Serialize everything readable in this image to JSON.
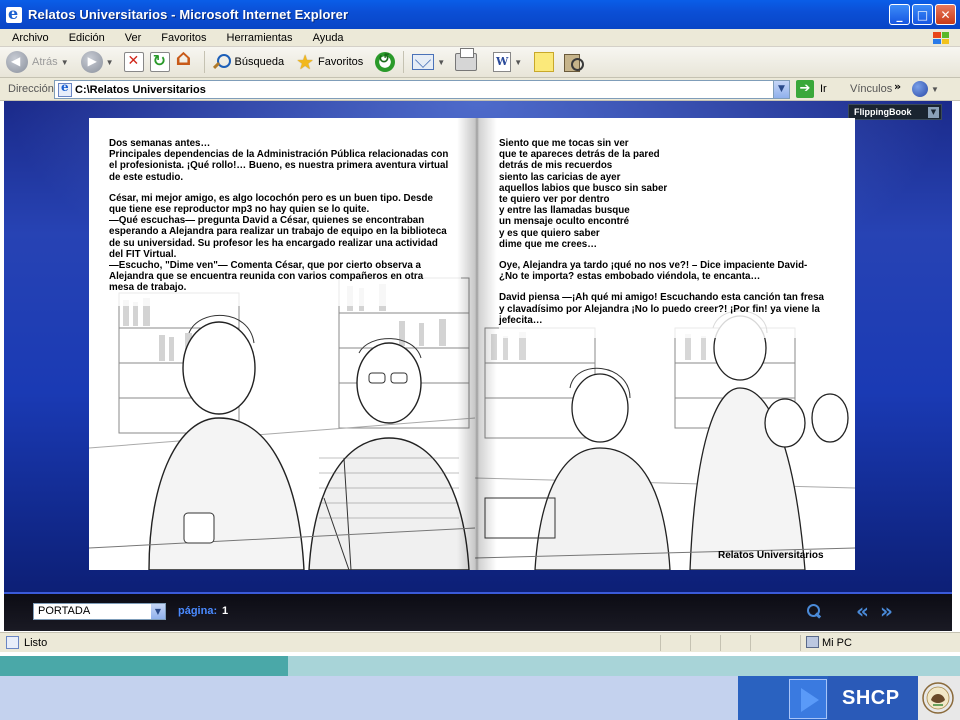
{
  "window": {
    "title": "Relatos Universitarios - Microsoft Internet Explorer",
    "controls": [
      "minimize",
      "maximize",
      "close"
    ]
  },
  "menu": {
    "items": [
      "Archivo",
      "Edición",
      "Ver",
      "Favoritos",
      "Herramientas",
      "Ayuda"
    ]
  },
  "toolbar": {
    "back_label": "Atrás",
    "search_label": "Búsqueda",
    "favorites_label": "Favoritos",
    "word_glyph": "W"
  },
  "address": {
    "label": "Dirección",
    "value": "C:\\Relatos Universitarios",
    "go_label": "Ir",
    "links_label": "Vínculos",
    "links_chevron": "»"
  },
  "viewer": {
    "tab_label": "FlippingBook",
    "left_page": {
      "paragraphs": [
        [
          "Dos semanas antes…",
          "Principales dependencias de la Administración Pública relacionadas con",
          "el profesionista. ¡Qué rollo!… Bueno, es nuestra primera aventura virtual",
          "de este estudio."
        ],
        [
          "César, mi mejor amigo, es algo locochón pero es  un buen tipo. Desde",
          "que tiene ese reproductor mp3 no hay quien se lo quite.",
          "—Qué escuchas— pregunta David a César, quienes se encontraban",
          "esperando a Alejandra para realizar un trabajo de equipo en la biblioteca",
          "de su universidad. Su profesor les ha encargado realizar una actividad",
          "del FIT Virtual.",
          "—Escucho, \"Dime ven\"— Comenta César, que por cierto observa a",
          "Alejandra que se encuentra reunida con varios compañeros en otra",
          "mesa de trabajo."
        ]
      ]
    },
    "right_page": {
      "paragraphs": [
        [
          "Siento que me tocas sin ver",
          "que te apareces detrás de la pared",
          "detrás de mis recuerdos",
          "siento las caricias de ayer",
          "aquellos labios que busco sin saber",
          "te quiero ver por dentro",
          "y entre las llamadas busque",
          "un mensaje oculto encontré",
          "y es que quiero saber",
          "dime que me crees…"
        ],
        [
          "Oye, Alejandra ya tardo ¡qué no nos ve?! – Dice impaciente David-",
          "¿No te importa? estas embobado viéndola, te encanta…"
        ],
        [
          "David piensa —¡Ah qué mi amigo! Escuchando esta canción tan fresa",
          "y clavadísimo por Alejandra ¡No lo puedo creer?! ¡Por fin! ya viene la",
          "jefecita…"
        ]
      ],
      "caption": "Relatos Universitarios"
    },
    "nav": {
      "chapter_selected": "PORTADA",
      "page_label": "página:",
      "page_value": "1"
    }
  },
  "status": {
    "text": "Listo",
    "zone": "Mi PC"
  },
  "footer": {
    "brand": "SHCP"
  },
  "colors": {
    "titlebar": "#0b4fd6",
    "viewer_bg": "#2743b4",
    "page_label": "#4a8aff",
    "footer_teal": "#4aa8a8",
    "footer_blue": "#2a5ab8"
  }
}
